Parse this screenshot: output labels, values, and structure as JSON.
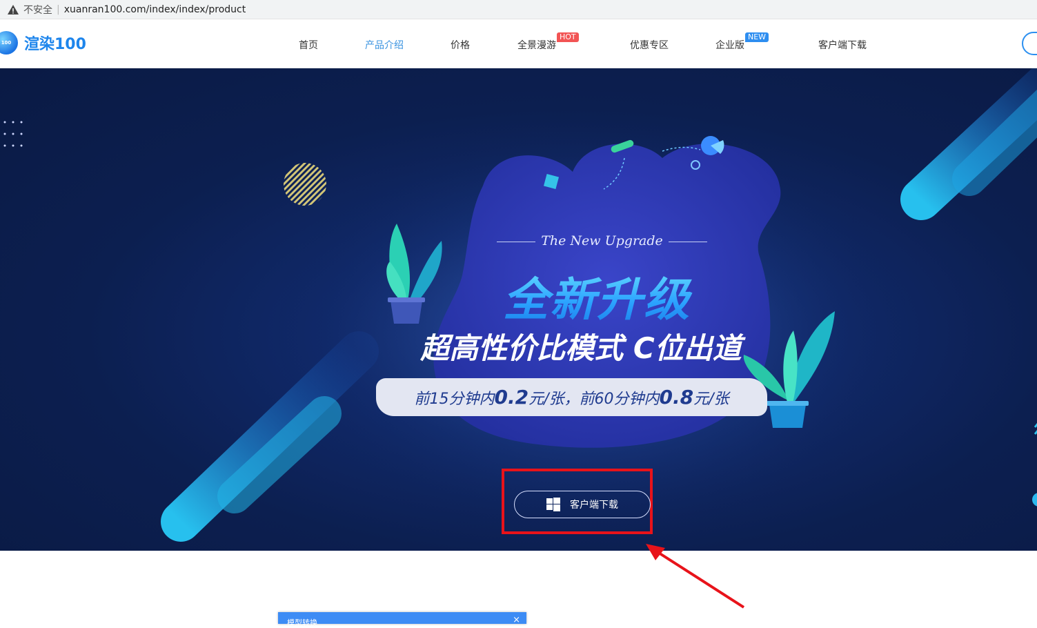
{
  "browser": {
    "security_label": "不安全",
    "url": "xuanran100.com/index/index/product"
  },
  "nav": {
    "logo_badge": "100",
    "logo_text": "渲染100",
    "items": [
      {
        "label": "首页"
      },
      {
        "label": "产品介绍"
      },
      {
        "label": "价格"
      },
      {
        "label": "全景漫游",
        "badge": "HOT"
      },
      {
        "label": "优惠专区"
      },
      {
        "label": "企业版",
        "badge": "NEW"
      },
      {
        "label": "客户端下载"
      }
    ]
  },
  "hero": {
    "tagline_en": "The New Upgrade",
    "title_cn": "全新升级",
    "subtitle_cn": "超高性价比模式 C位出道",
    "price": {
      "part1": "前15分钟内 ",
      "value1": "0.2",
      "unit1": "元/张，前60分钟内 ",
      "value2": "0.8",
      "unit2": "元/张"
    },
    "download_button": "客户端下载"
  },
  "dialog": {
    "title": "模型转换",
    "close": "×"
  },
  "colors": {
    "accent": "#3a93e0",
    "hero_bg": "#0c1f50",
    "annotation": "#e8131a"
  }
}
